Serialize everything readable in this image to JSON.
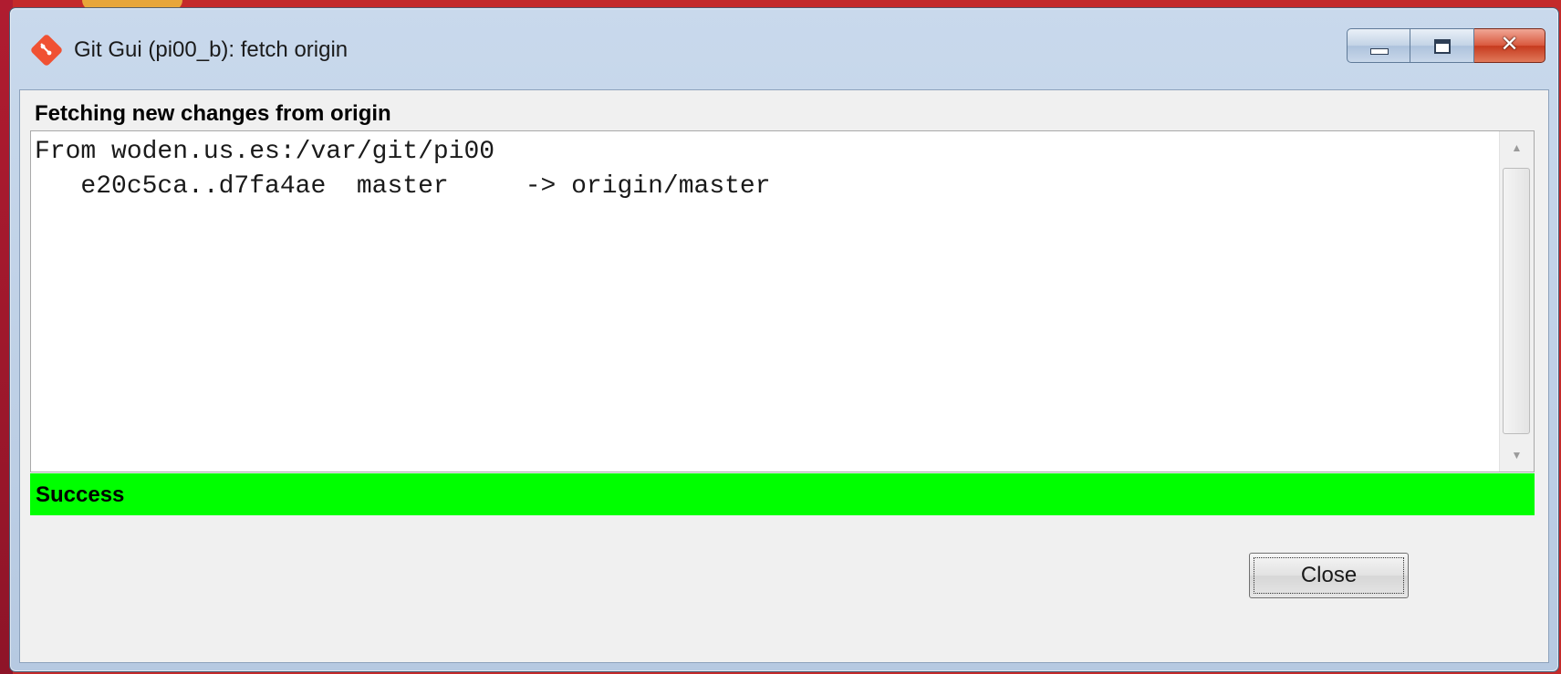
{
  "window": {
    "title": "Git Gui (pi00_b): fetch origin",
    "icon": "git-diamond-icon",
    "caption_buttons": [
      "minimize",
      "maximize",
      "close"
    ]
  },
  "dialog": {
    "heading": "Fetching new changes from origin",
    "log": {
      "lines": [
        "From woden.us.es:/var/git/pi00",
        "   e20c5ca..d7fa4ae  master     -> origin/master"
      ]
    },
    "status": {
      "text": "Success",
      "color": "#00ff00"
    },
    "close_button_label": "Close"
  },
  "colors": {
    "git_icon": "#f05133",
    "status_bg": "#00ff00"
  }
}
